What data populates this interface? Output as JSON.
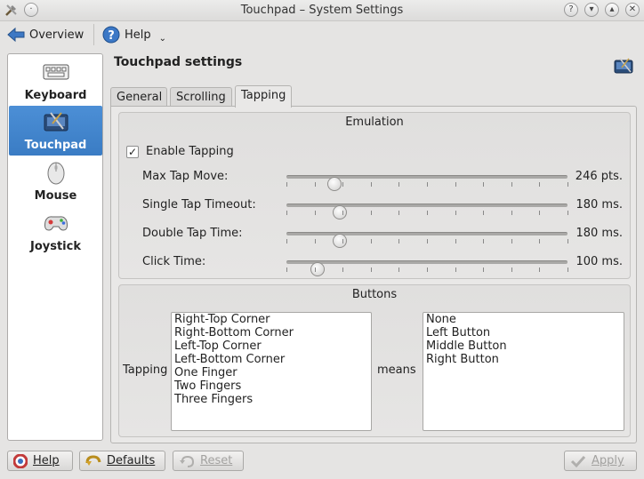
{
  "window": {
    "title": "Touchpad – System Settings"
  },
  "toolbar": {
    "overview_label": "Overview",
    "help_label": "Help"
  },
  "sidebar": {
    "items": [
      {
        "label": "Keyboard",
        "icon": "keyboard-icon",
        "active": false
      },
      {
        "label": "Touchpad",
        "icon": "touchpad-icon",
        "active": true
      },
      {
        "label": "Mouse",
        "icon": "mouse-icon",
        "active": false
      },
      {
        "label": "Joystick",
        "icon": "joystick-icon",
        "active": false
      }
    ]
  },
  "page": {
    "heading": "Touchpad settings"
  },
  "tabs": [
    {
      "label": "General",
      "active": false
    },
    {
      "label": "Scrolling",
      "active": false
    },
    {
      "label": "Tapping",
      "active": true
    }
  ],
  "emulation": {
    "title": "Emulation",
    "enable_tapping": {
      "label": "Enable Tapping",
      "checked": true
    },
    "sliders": [
      {
        "label": "Max Tap Move:",
        "value": "246 pts.",
        "position": 0.17
      },
      {
        "label": "Single Tap Timeout:",
        "value": "180 ms.",
        "position": 0.19
      },
      {
        "label": "Double Tap Time:",
        "value": "180 ms.",
        "position": 0.19
      },
      {
        "label": "Click Time:",
        "value": "100 ms.",
        "position": 0.11
      }
    ]
  },
  "buttons_group": {
    "title": "Buttons",
    "tapping_label": "Tapping",
    "means_label": "means",
    "tapping_options": [
      "Right-Top Corner",
      "Right-Bottom Corner",
      "Left-Top Corner",
      "Left-Bottom Corner",
      "One Finger",
      "Two Fingers",
      "Three Fingers"
    ],
    "means_options": [
      "None",
      "Left Button",
      "Middle Button",
      "Right Button"
    ]
  },
  "footer": {
    "help_label": "Help",
    "defaults_label": "Defaults",
    "reset_label": "Reset",
    "apply_label": "Apply"
  },
  "colors": {
    "accent": "#3a7cc4",
    "background": "#e5e4e3"
  }
}
